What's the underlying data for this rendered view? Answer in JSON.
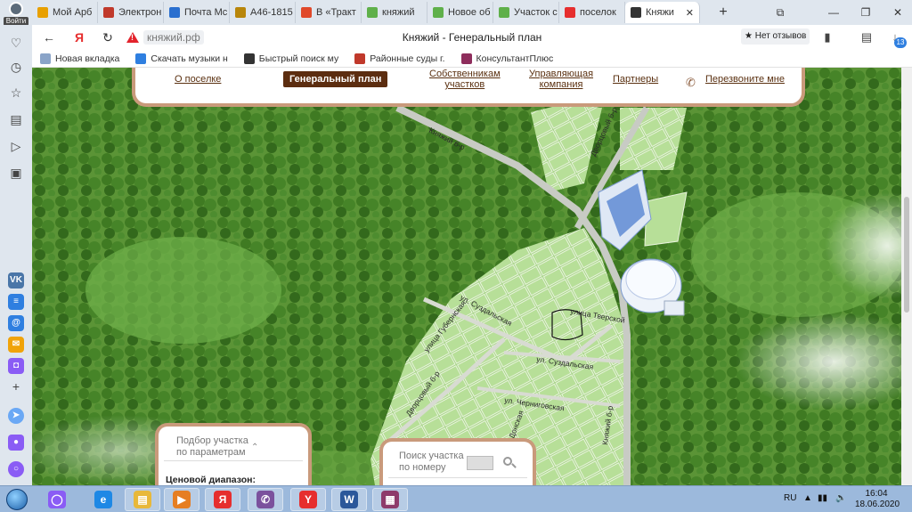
{
  "profile": {
    "label": "Войти"
  },
  "tabs": [
    {
      "title": "Мой Арб",
      "color": "#e8a000"
    },
    {
      "title": "Электрон",
      "color": "#c0392b"
    },
    {
      "title": "Почта Mc",
      "color": "#2a6fcf"
    },
    {
      "title": "А46-1815",
      "color": "#b8860b"
    },
    {
      "title": "В «Тракт",
      "color": "#e0492b"
    },
    {
      "title": "княжий",
      "color": "#5fb04a"
    },
    {
      "title": "Новое об",
      "color": "#5fb04a"
    },
    {
      "title": "Участок с",
      "color": "#5fb04a"
    },
    {
      "title": "поселок",
      "color": "#e62e2e"
    },
    {
      "title": "Княжи",
      "color": "#333333",
      "close": "✕"
    }
  ],
  "new_tab": "+",
  "window": {
    "minimize": "—",
    "restore": "❐",
    "close": "✕",
    "bookmark_icon": "⧉"
  },
  "address": {
    "url": "княжий.рф",
    "page_title": "Княжий - Генеральный план",
    "reviews": "★ Нет отзывов",
    "downloads_count": "13"
  },
  "nav_icons": {
    "back": "←",
    "yandex": "Я",
    "reload": "↻"
  },
  "bookmarks": [
    {
      "label": "Новая вкладка",
      "icon": "new-tab"
    },
    {
      "label": "Скачать музыки н",
      "icon": "music"
    },
    {
      "label": "Быстрый поиск му",
      "icon": "search"
    },
    {
      "label": "Районные суды г.",
      "icon": "court"
    },
    {
      "label": "КонсультантПлюс",
      "icon": "consultant"
    }
  ],
  "sidebar_icons": [
    "bell-icon",
    "clock-icon",
    "star-icon",
    "notes-icon",
    "play-icon",
    "screenshot-icon"
  ],
  "sidebar_apps": [
    {
      "name": "vk",
      "glyph": "VK",
      "color": "#4a76a8"
    },
    {
      "name": "docs",
      "glyph": "≡",
      "color": "#2f7fe0"
    },
    {
      "name": "mail",
      "glyph": "@",
      "color": "#2f7fe0"
    },
    {
      "name": "mail-ru",
      "glyph": "✉",
      "color": "#f0a30a"
    },
    {
      "name": "messenger",
      "glyph": "◘",
      "color": "#8a5cf5"
    }
  ],
  "site_menu": {
    "about": "О поселке",
    "master_plan": "Генеральный план",
    "owners_line1": "Собственникам",
    "owners_line2": "участков",
    "management_line1": "Управляющая",
    "management_line2": "компания",
    "partners": "Партнеры",
    "call_me": "Перезвоните мне"
  },
  "map_labels": {
    "knyazhiy_1": "Княжий б-р",
    "dvortsovy_top": "Дворцовый б-р",
    "suzdalskaya_1": "ул. Суздальская",
    "tverskaya": "улица Тверской",
    "gubernsky": "улица Губернская",
    "suzdalskaya_2": "ул. Суздальская",
    "chernigovskaya": "ул. Черниговская",
    "donskaya": "ул. Донская",
    "dvortsovy_bottom": "Дворцовый б-р",
    "knyazhiy_2": "Княжий б-р"
  },
  "filter_panel": {
    "title_line1": "Подбор участка",
    "title_line2": "по параметрам",
    "chevron": "⌃",
    "price_range": "Ценовой диапазон:"
  },
  "number_panel": {
    "title_line1": "Поиск участка",
    "title_line2": "по номеру"
  },
  "taskbar": {
    "apps": [
      {
        "name": "alice",
        "glyph": "◯",
        "color": "#8a5cf5",
        "open": false
      },
      {
        "name": "ie",
        "glyph": "e",
        "color": "#1e88e5",
        "open": false
      },
      {
        "name": "explorer",
        "glyph": "▤",
        "color": "#e8b83a",
        "open": true
      },
      {
        "name": "media",
        "glyph": "▶",
        "color": "#e67e22",
        "open": true
      },
      {
        "name": "yandex",
        "glyph": "Я",
        "color": "#e62e2e",
        "open": true
      },
      {
        "name": "viber",
        "glyph": "✆",
        "color": "#7b519d",
        "open": true
      },
      {
        "name": "yandex-browser",
        "glyph": "Y",
        "color": "#e62e2e",
        "open": true
      },
      {
        "name": "word",
        "glyph": "W",
        "color": "#2b579a",
        "open": true
      },
      {
        "name": "winrar",
        "glyph": "▦",
        "color": "#8e3a6b",
        "open": true
      }
    ],
    "lang": "RU",
    "time": "16:04",
    "date": "18.06.2020"
  }
}
